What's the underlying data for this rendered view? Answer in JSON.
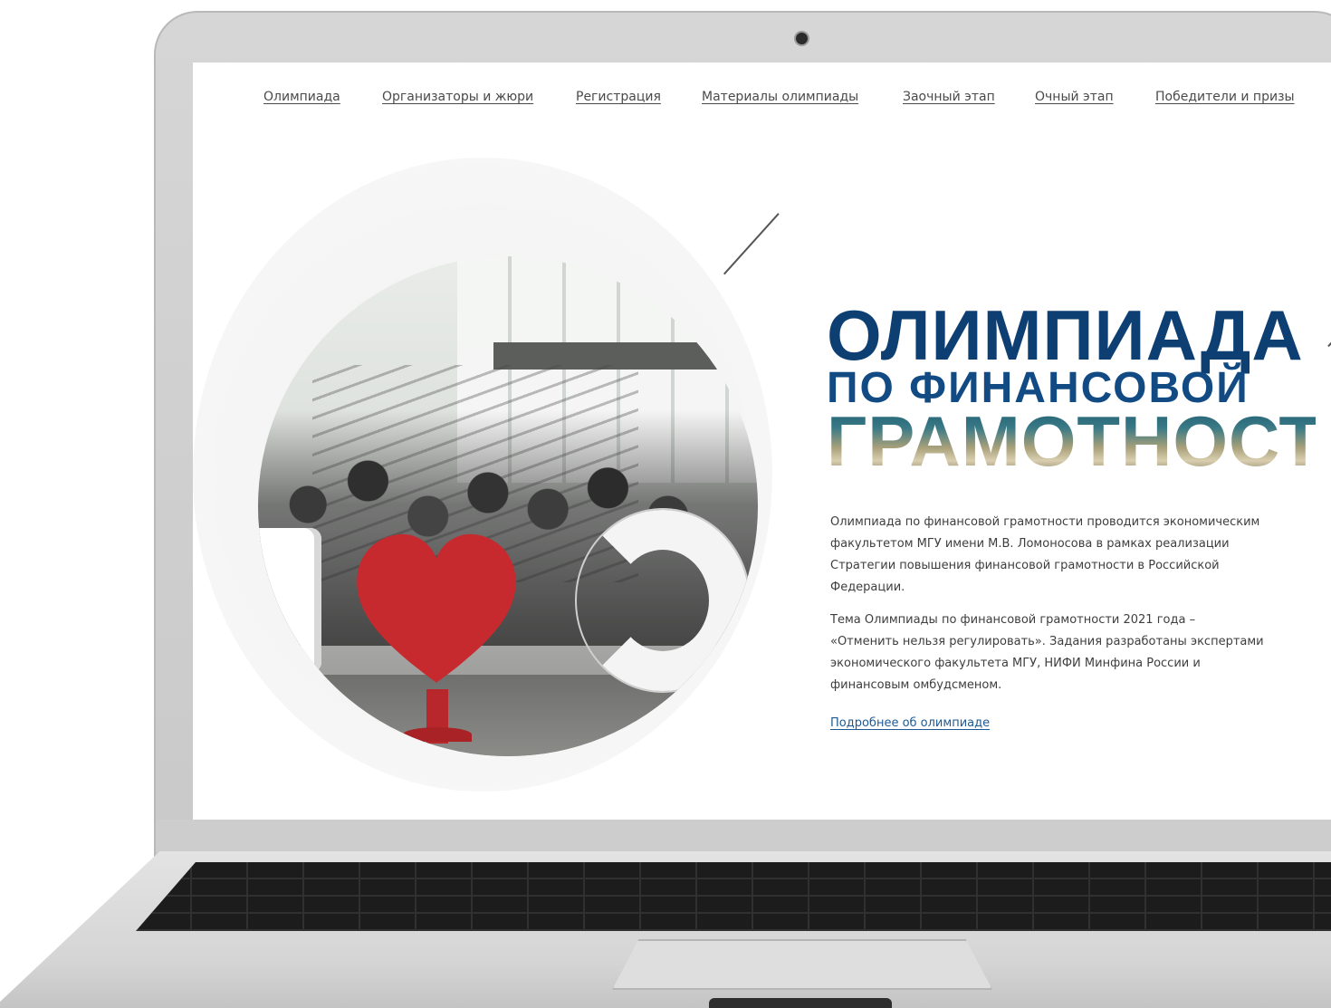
{
  "nav": {
    "items": [
      {
        "label": "Олимпиада"
      },
      {
        "label": "Организаторы и жюри"
      },
      {
        "label": "Регистрация"
      },
      {
        "label": "Материалы олимпиады"
      },
      {
        "label": "Заочный этап"
      },
      {
        "label": "Очный этап"
      },
      {
        "label": "Победители и призы"
      }
    ]
  },
  "hero": {
    "title_line1": "ОЛИМПИАДА",
    "title_line2": "ПО ФИНАНСОВОЙ",
    "title_line3": "ГРАМОТНОСТИ",
    "paragraph1": "Олимпиада по финансовой грамотности проводится экономическим факультетом МГУ имени М.В. Ломоносова в рамках реализации Стратегии повышения финансовой грамотности в Российской Федерации.",
    "paragraph2": "Тема Олимпиады по финансовой грамотности 2021 года – «Отменить нельзя регулировать». Задания разработаны экспертами экономического факультета МГУ, НИФИ Минфина России и финансовым омбудсменом.",
    "more_link": "Подробнее об олимпиаде"
  },
  "colors": {
    "title_blue": "#0e3f73",
    "link_blue": "#1d5a95",
    "heart_red": "#c62a2f"
  }
}
